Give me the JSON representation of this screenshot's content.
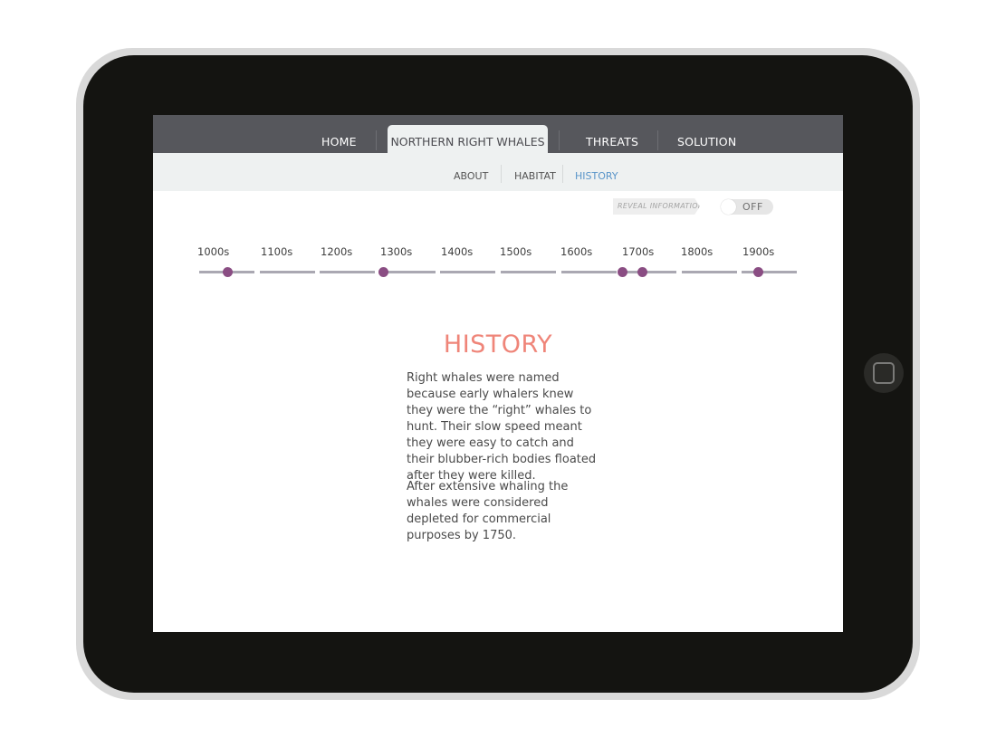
{
  "nav": {
    "items": [
      "HOME",
      "NORTHERN RIGHT WHALES",
      "THREATS",
      "SOLUTION"
    ],
    "active_index": 1
  },
  "subnav": {
    "items": [
      "ABOUT",
      "HABITAT",
      "HISTORY"
    ],
    "active_index": 2
  },
  "reveal": {
    "label": "REVEAL INFORMATION",
    "toggle_state": "OFF"
  },
  "timeline": {
    "centuries": [
      "1000s",
      "1100s",
      "1200s",
      "1300s",
      "1400s",
      "1500s",
      "1600s",
      "1700s",
      "1800s",
      "1900s"
    ],
    "marker_color": "#8a4d83",
    "bar_color": "#aaa8b2"
  },
  "content": {
    "title": "HISTORY",
    "paragraph1": "Right whales were named because early whalers knew they were the “right” whales to hunt. Their slow speed meant they were easy to catch and their blubber-rich bodies floated after they were killed.",
    "paragraph2": "After extensive whaling the whales were considered depleted for commercial purposes by 1750."
  },
  "colors": {
    "title": "#ef8579",
    "nav_background": "#56575c",
    "subnav_active": "#5a95c9"
  }
}
